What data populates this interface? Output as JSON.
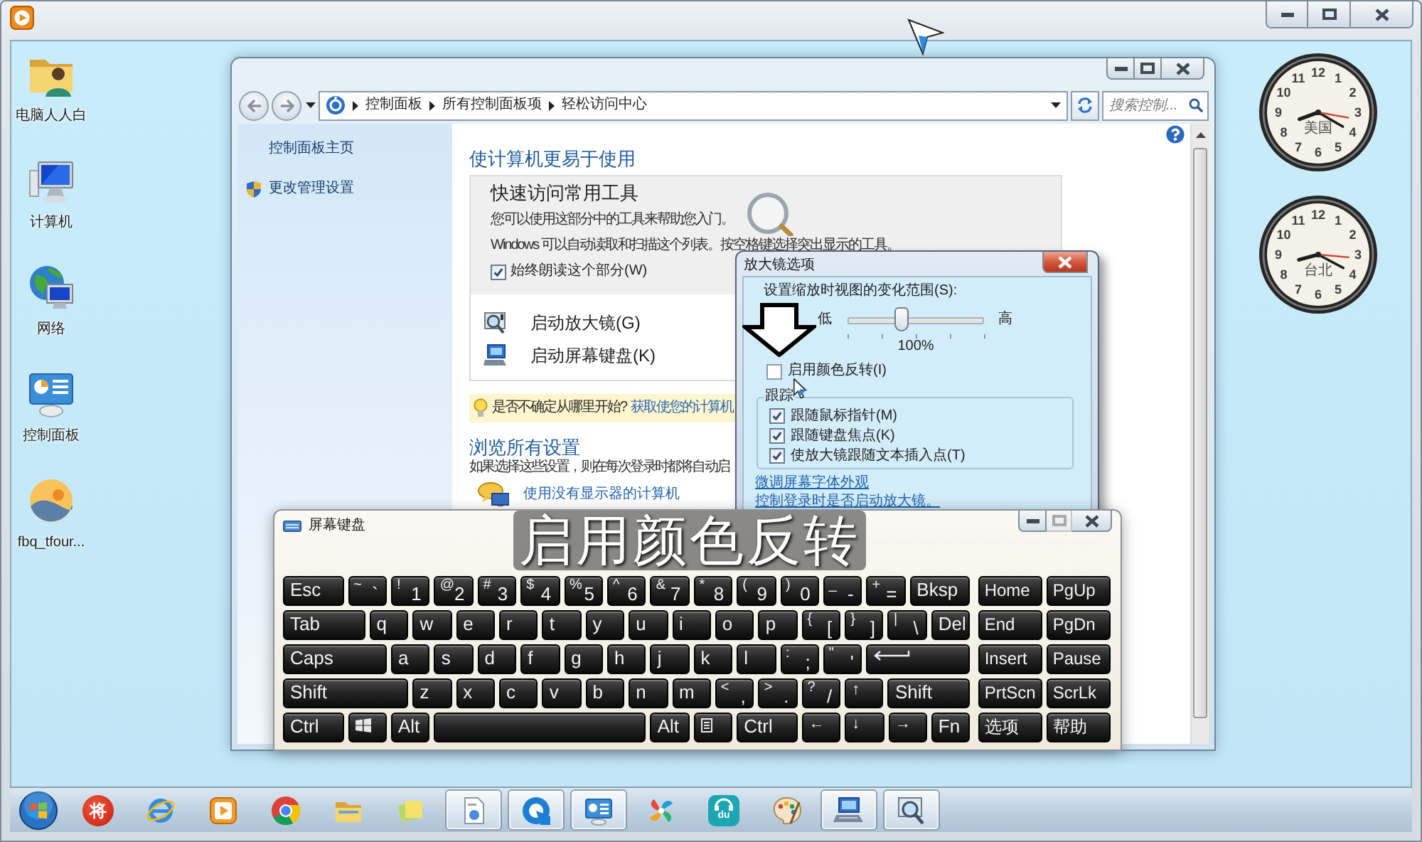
{
  "desktop_icons": [
    {
      "kind": "user_folder",
      "label": "电脑人人白"
    },
    {
      "kind": "computer",
      "label": "计算机"
    },
    {
      "kind": "network",
      "label": "网络"
    },
    {
      "kind": "control_panel",
      "label": "控制面板"
    },
    {
      "kind": "landscape",
      "label": "fbq_tfour..."
    }
  ],
  "clocks": [
    {
      "label": "美国",
      "numerals": [
        "12",
        "11",
        "1",
        "10",
        "2",
        "9",
        "3",
        "8",
        "4",
        "7",
        "5",
        "6"
      ]
    },
    {
      "label": "台北",
      "numerals": [
        "12",
        "11",
        "1",
        "10",
        "2",
        "9",
        "3",
        "8",
        "4",
        "7",
        "5",
        "6"
      ]
    }
  ],
  "control_panel": {
    "breadcrumb": [
      {
        "label": "控制面板"
      },
      {
        "label": "所有控制面板项"
      },
      {
        "label": "轻松访问中心"
      }
    ],
    "search": {
      "placeholder": "搜索控制..."
    },
    "sidebar": {
      "items": [
        {
          "kind": "link",
          "label": "控制面板主页"
        },
        {
          "kind": "shield_link",
          "label": "更改管理设置"
        }
      ]
    },
    "heading": "使计算机更易于使用",
    "quick_access": {
      "title": "快速访问常用工具",
      "lines": [
        "您可以使用这部分中的工具来帮助您入门。",
        "Windows 可以自动读取和扫描这个列表。按空格键选择突出显示的工具。"
      ],
      "read_aloud": {
        "label": "始终朗读这个部分(W)",
        "checked": true
      },
      "tools": [
        {
          "kind": "magnifier",
          "label": "启动放大镜(G)"
        },
        {
          "kind": "keyboard",
          "label": "启动屏幕键盘(K)"
        }
      ]
    },
    "hint": {
      "text": "是否不确定从哪里开始?",
      "link": "获取使您的计算机"
    },
    "browse": {
      "title": "浏览所有设置",
      "description": "如果选择这些设置，则在每次登录时都将自动启",
      "items": [
        {
          "kind": "no_display",
          "label": "使用没有显示器的计算机"
        }
      ]
    }
  },
  "magnifier_options": {
    "title": "放大镜选项",
    "zoom_label": "设置缩放时视图的变化范围(S):",
    "low": "低",
    "high": "高",
    "zoom": {
      "level": 0.4
    },
    "zoom_value": "100%",
    "invert": {
      "label": "启用颜色反转(I)",
      "checked": false
    },
    "tracking": {
      "title": "跟踪",
      "options": [
        {
          "label": "跟随鼠标指针(M)",
          "checked": true
        },
        {
          "label": "跟随键盘焦点(K)",
          "checked": true
        },
        {
          "label": "使放大镜跟随文本插入点(T)",
          "checked": true
        }
      ]
    },
    "links": [
      "微调屏幕字体外观",
      "控制登录时是否启动放大镜。"
    ]
  },
  "on_screen_keyboard": {
    "title": "屏幕键盘",
    "rows": [
      {
        "keys": [
          {
            "kind": "label",
            "label": "Esc"
          },
          {
            "kind": "pair",
            "shift": "~",
            "label": "`"
          },
          {
            "kind": "pair",
            "shift": "!",
            "label": "1"
          },
          {
            "kind": "pair",
            "shift": "@",
            "label": "2"
          },
          {
            "kind": "pair",
            "shift": "#",
            "label": "3"
          },
          {
            "kind": "pair",
            "shift": "$",
            "label": "4"
          },
          {
            "kind": "pair",
            "shift": "%",
            "label": "5"
          },
          {
            "kind": "pair",
            "shift": "^",
            "label": "6"
          },
          {
            "kind": "pair",
            "shift": "&",
            "label": "7"
          },
          {
            "kind": "pair",
            "shift": "*",
            "label": "8"
          },
          {
            "kind": "pair",
            "shift": "(",
            "label": "9"
          },
          {
            "kind": "pair",
            "shift": ")",
            "label": "0"
          },
          {
            "kind": "pair",
            "shift": "_",
            "label": "-"
          },
          {
            "kind": "pair",
            "shift": "+",
            "label": "="
          },
          {
            "kind": "label",
            "label": "Bksp"
          }
        ]
      },
      {
        "keys": [
          {
            "kind": "label",
            "label": "Tab"
          },
          {
            "kind": "label",
            "label": "q"
          },
          {
            "kind": "label",
            "label": "w"
          },
          {
            "kind": "label",
            "label": "e"
          },
          {
            "kind": "label",
            "label": "r"
          },
          {
            "kind": "label",
            "label": "t"
          },
          {
            "kind": "label",
            "label": "y"
          },
          {
            "kind": "label",
            "label": "u"
          },
          {
            "kind": "label",
            "label": "i"
          },
          {
            "kind": "label",
            "label": "o"
          },
          {
            "kind": "label",
            "label": "p"
          },
          {
            "kind": "pair",
            "shift": "{",
            "label": "["
          },
          {
            "kind": "pair",
            "shift": "}",
            "label": "]"
          },
          {
            "kind": "pair",
            "shift": "|",
            "label": "\\"
          },
          {
            "kind": "label",
            "label": "Del"
          }
        ]
      },
      {
        "keys": [
          {
            "kind": "label",
            "label": "Caps"
          },
          {
            "kind": "label",
            "label": "a"
          },
          {
            "kind": "label",
            "label": "s"
          },
          {
            "kind": "label",
            "label": "d"
          },
          {
            "kind": "label",
            "label": "f"
          },
          {
            "kind": "label",
            "label": "g"
          },
          {
            "kind": "label",
            "label": "h"
          },
          {
            "kind": "label",
            "label": "j"
          },
          {
            "kind": "label",
            "label": "k"
          },
          {
            "kind": "label",
            "label": "l"
          },
          {
            "kind": "pair",
            "shift": ":",
            "label": ";"
          },
          {
            "kind": "pair",
            "shift": "\"",
            "label": "'"
          },
          {
            "kind": "enter"
          }
        ]
      },
      {
        "keys": [
          {
            "kind": "label",
            "label": "Shift"
          },
          {
            "kind": "label",
            "label": "z"
          },
          {
            "kind": "label",
            "label": "x"
          },
          {
            "kind": "label",
            "label": "c"
          },
          {
            "kind": "label",
            "label": "v"
          },
          {
            "kind": "label",
            "label": "b"
          },
          {
            "kind": "label",
            "label": "n"
          },
          {
            "kind": "label",
            "label": "m"
          },
          {
            "kind": "pair",
            "shift": "<",
            "label": ","
          },
          {
            "kind": "pair",
            "shift": ">",
            "label": "."
          },
          {
            "kind": "pair",
            "shift": "?",
            "label": "/"
          },
          {
            "kind": "arrow",
            "label": "↑"
          },
          {
            "kind": "label",
            "label": "Shift"
          }
        ]
      },
      {
        "keys": [
          {
            "kind": "label",
            "label": "Ctrl"
          },
          {
            "kind": "windows"
          },
          {
            "kind": "label",
            "label": "Alt"
          },
          {
            "kind": "space"
          },
          {
            "kind": "label",
            "label": "Alt"
          },
          {
            "kind": "menu"
          },
          {
            "kind": "label",
            "label": "Ctrl"
          },
          {
            "kind": "arrow",
            "label": "←"
          },
          {
            "kind": "arrow",
            "label": "↓"
          },
          {
            "kind": "arrow",
            "label": "→"
          },
          {
            "kind": "label",
            "label": "Fn"
          }
        ]
      }
    ],
    "nav_rows": [
      {
        "keys": [
          {
            "label": "Home"
          },
          {
            "label": "PgUp"
          }
        ]
      },
      {
        "keys": [
          {
            "label": "End"
          },
          {
            "label": "PgDn"
          }
        ]
      },
      {
        "keys": [
          {
            "label": "Insert"
          },
          {
            "label": "Pause"
          }
        ]
      },
      {
        "keys": [
          {
            "label": "PrtScn"
          },
          {
            "label": "ScrLk"
          }
        ]
      },
      {
        "keys": [
          {
            "label": "选项"
          },
          {
            "label": "帮助"
          }
        ]
      }
    ]
  },
  "caption": "启用颜色反转",
  "taskbar": {
    "items": [
      {
        "kind": "glyph",
        "label": "将",
        "running": false
      },
      {
        "kind": "browser_e",
        "running": false
      },
      {
        "kind": "player",
        "running": false
      },
      {
        "kind": "browser_round",
        "running": false
      },
      {
        "kind": "folder",
        "running": false
      },
      {
        "kind": "notes",
        "running": false
      },
      {
        "kind": "document",
        "running": true
      },
      {
        "kind": "ring",
        "running": true
      },
      {
        "kind": "panel",
        "running": true
      },
      {
        "kind": "pinwheel",
        "running": false
      },
      {
        "kind": "headphones",
        "label": "du",
        "running": false
      },
      {
        "kind": "palette",
        "running": false
      },
      {
        "kind": "keyboard",
        "running": true
      },
      {
        "kind": "magnifier",
        "running": true
      }
    ]
  }
}
